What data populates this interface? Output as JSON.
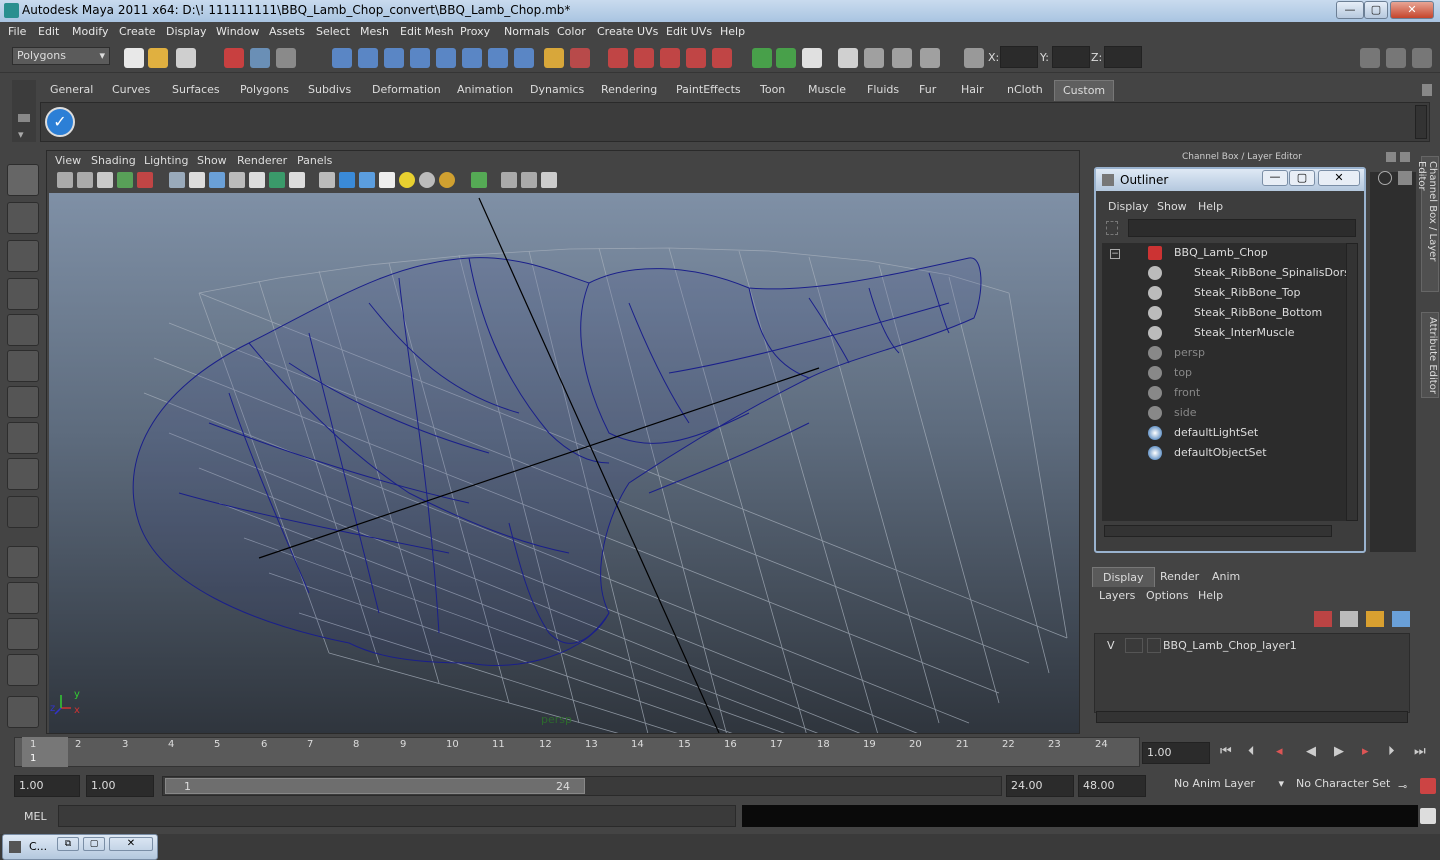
{
  "window": {
    "title": "Autodesk Maya 2011 x64: D:\\! 111111111\\BBQ_Lamb_Chop_convert\\BBQ_Lamb_Chop.mb*",
    "min": "—",
    "max": "▢",
    "close": "✕"
  },
  "menubar": [
    "File",
    "Edit",
    "Modify",
    "Create",
    "Display",
    "Window",
    "Assets",
    "Select",
    "Mesh",
    "Edit Mesh",
    "Proxy",
    "Normals",
    "Color",
    "Create UVs",
    "Edit UVs",
    "Help"
  ],
  "status": {
    "mode": "Polygons",
    "x_label": "X:",
    "y_label": "Y:",
    "z_label": "Z:"
  },
  "shelf_tabs": [
    "General",
    "Curves",
    "Surfaces",
    "Polygons",
    "Subdivs",
    "Deformation",
    "Animation",
    "Dynamics",
    "Rendering",
    "PaintEffects",
    "Toon",
    "Muscle",
    "Fluids",
    "Fur",
    "Hair",
    "nCloth",
    "Custom"
  ],
  "shelf_active": "Custom",
  "viewport": {
    "menu": [
      "View",
      "Shading",
      "Lighting",
      "Show",
      "Renderer",
      "Panels"
    ],
    "camera_label": "persp",
    "axis_x": "x",
    "axis_y": "y",
    "axis_z": "z"
  },
  "rightpanel": {
    "header": "Channel Box / Layer Editor",
    "side_tab1": "Channel Box / Layer Editor",
    "side_tab2": "Attribute Editor"
  },
  "outliner": {
    "title": "Outliner",
    "menu": [
      "Display",
      "Show",
      "Help"
    ],
    "items": [
      {
        "label": "BBQ_Lamb_Chop",
        "indent": 0,
        "dim": false,
        "icon": "mesh-group-icon"
      },
      {
        "label": "Steak_RibBone_SpinalisDorsi",
        "indent": 1,
        "dim": false,
        "icon": "mesh-icon"
      },
      {
        "label": "Steak_RibBone_Top",
        "indent": 1,
        "dim": false,
        "icon": "mesh-icon"
      },
      {
        "label": "Steak_RibBone_Bottom",
        "indent": 1,
        "dim": false,
        "icon": "mesh-icon"
      },
      {
        "label": "Steak_InterMuscle",
        "indent": 1,
        "dim": false,
        "icon": "mesh-icon"
      },
      {
        "label": "persp",
        "indent": 0,
        "dim": true,
        "icon": "camera-icon"
      },
      {
        "label": "top",
        "indent": 0,
        "dim": true,
        "icon": "camera-icon"
      },
      {
        "label": "front",
        "indent": 0,
        "dim": true,
        "icon": "camera-icon"
      },
      {
        "label": "side",
        "indent": 0,
        "dim": true,
        "icon": "camera-icon"
      },
      {
        "label": "defaultLightSet",
        "indent": 0,
        "dim": false,
        "icon": "set-icon"
      },
      {
        "label": "defaultObjectSet",
        "indent": 0,
        "dim": false,
        "icon": "set-icon"
      }
    ]
  },
  "layers": {
    "tabs": [
      "Display",
      "Render",
      "Anim"
    ],
    "active_tab": "Display",
    "menu": [
      "Layers",
      "Options",
      "Help"
    ],
    "layer_vis": "V",
    "layer_name": "BBQ_Lamb_Chop_layer1"
  },
  "timeline": {
    "ticks": [
      "1",
      "2",
      "3",
      "4",
      "5",
      "6",
      "7",
      "8",
      "9",
      "10",
      "11",
      "12",
      "13",
      "14",
      "15",
      "16",
      "17",
      "18",
      "19",
      "20",
      "21",
      "22",
      "23",
      "24"
    ],
    "current_frame": "1",
    "current_time": "1.00"
  },
  "range": {
    "start": "1.00",
    "playback_start": "1.00",
    "slider_start": "1",
    "slider_end": "24",
    "playback_end": "24.00",
    "end": "48.00",
    "anim_layer": "No Anim Layer",
    "char_set": "No Character Set"
  },
  "cmd": {
    "label": "MEL"
  },
  "taskbar": {
    "label": "C..."
  }
}
